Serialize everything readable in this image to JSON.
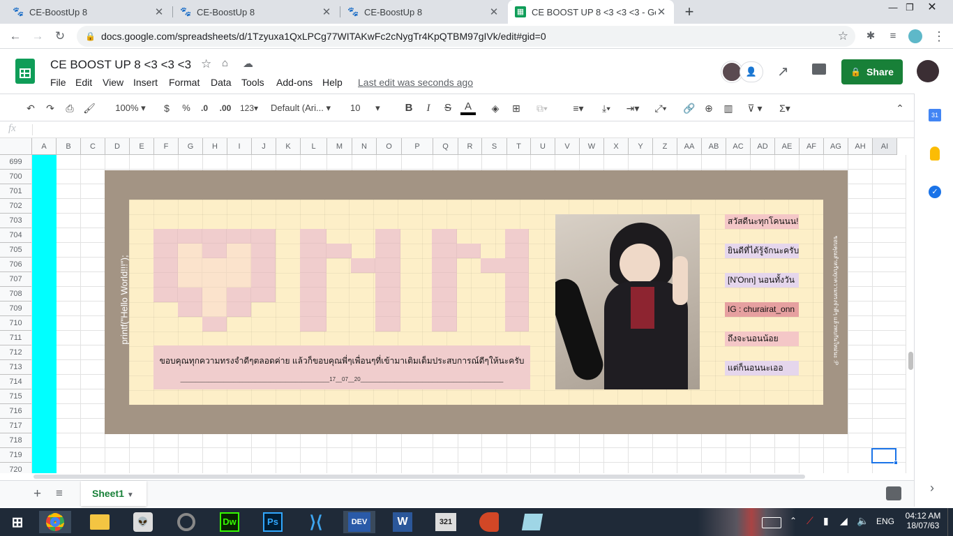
{
  "browser": {
    "tabs": [
      {
        "title": "CE-BoostUp 8",
        "active": false
      },
      {
        "title": "CE-BoostUp 8",
        "active": false
      },
      {
        "title": "CE-BoostUp 8",
        "active": false
      },
      {
        "title": "CE BOOST UP 8 <3 <3 <3 - Go",
        "active": true
      }
    ],
    "new_tab": "+",
    "url": "docs.google.com/spreadsheets/d/1Tzyuxa1QxLPCg77WITAKwFc2cNygTr4KpQTBM97gIVk/edit#gid=0"
  },
  "doc": {
    "title": "CE BOOST UP 8 <3 <3 <3",
    "menus": [
      "File",
      "Edit",
      "View",
      "Insert",
      "Format",
      "Data",
      "Tools",
      "Add-ons",
      "Help"
    ],
    "last_edit": "Last edit was seconds ago",
    "share_label": "Share"
  },
  "toolbar": {
    "zoom": "100%",
    "currency": "$",
    "percent": "%",
    "dec_less": ".0",
    "dec_more": ".00",
    "format_more": "123",
    "font": "Default (Ari...",
    "font_size": "10",
    "bold": "B",
    "italic": "I",
    "strike": "S",
    "text_color": "A"
  },
  "formula_bar": {
    "fx": "fx",
    "value": ""
  },
  "grid": {
    "columns": [
      "A",
      "B",
      "C",
      "D",
      "E",
      "F",
      "G",
      "H",
      "I",
      "J",
      "K",
      "L",
      "M",
      "N",
      "O",
      "P",
      "Q",
      "R",
      "S",
      "T",
      "U",
      "V",
      "W",
      "X",
      "Y",
      "Z",
      "AA",
      "AB",
      "AC",
      "AD",
      "AE",
      "AF",
      "AG",
      "AH",
      "AI"
    ],
    "rows": [
      "699",
      "700",
      "701",
      "702",
      "703",
      "704",
      "705",
      "706",
      "707",
      "708",
      "709",
      "710",
      "711",
      "712",
      "713",
      "714",
      "715",
      "716",
      "717",
      "718",
      "719",
      "720"
    ],
    "left_vertical_text": "printf(\"Hello World!!!\");",
    "thanks_text": "ขอบคุณทุกความทรงจำดีๆตลอดค่าย  แล้วก็ขอบคุณพี่ๆเพื่อนๆที่เข้ามาเติมเต็มประสบการณ์ดีๆให้นะครับ",
    "signature_line": "________________________________________________17__07__20______________________________________________",
    "right_messages": [
      "สวัสดีนะทุกโคนนน!!",
      "ยินดีที่ได้รู้จักนะครับ",
      "[N'Onn] นอนทั้งวัน",
      "IG : churairat_onn",
      "ถึงจะนอนน้อย",
      "แต่ก็นอนนะเออ"
    ],
    "right_vertical_text": "ขอบคุณสำหรับทุกความทรงจำดีๆ แล้วพบกันใหม่นะ :P",
    "colors": {
      "frame": "#a39484",
      "canvas": "#fdefc8",
      "pixel_pink": "#f0cdcd",
      "pixel_light": "#fbe3cc",
      "cyan": "#00ffff",
      "msg_pink": "#f4c7c7",
      "msg_red": "#e6a0a0",
      "msg_lilac": "#e5d6ec"
    }
  },
  "sheet": {
    "add": "+",
    "list_icon": "≡",
    "name": "Sheet1"
  },
  "taskbar": {
    "apps": [
      "windows-start-icon",
      "chrome-icon",
      "file-explorer-icon",
      "alien-app-icon",
      "blender-app-icon",
      "Dw",
      "Ps",
      "vscode-icon",
      "DEV",
      "W",
      "321",
      "powerpoint-icon",
      "app-icon"
    ],
    "dw_label": "Dw",
    "ps_label": "Ps",
    "dev_label": "DEV",
    "word_label": "W",
    "player_label": "321",
    "lang": "ENG",
    "time": "04:12 AM",
    "date": "18/07/63"
  }
}
